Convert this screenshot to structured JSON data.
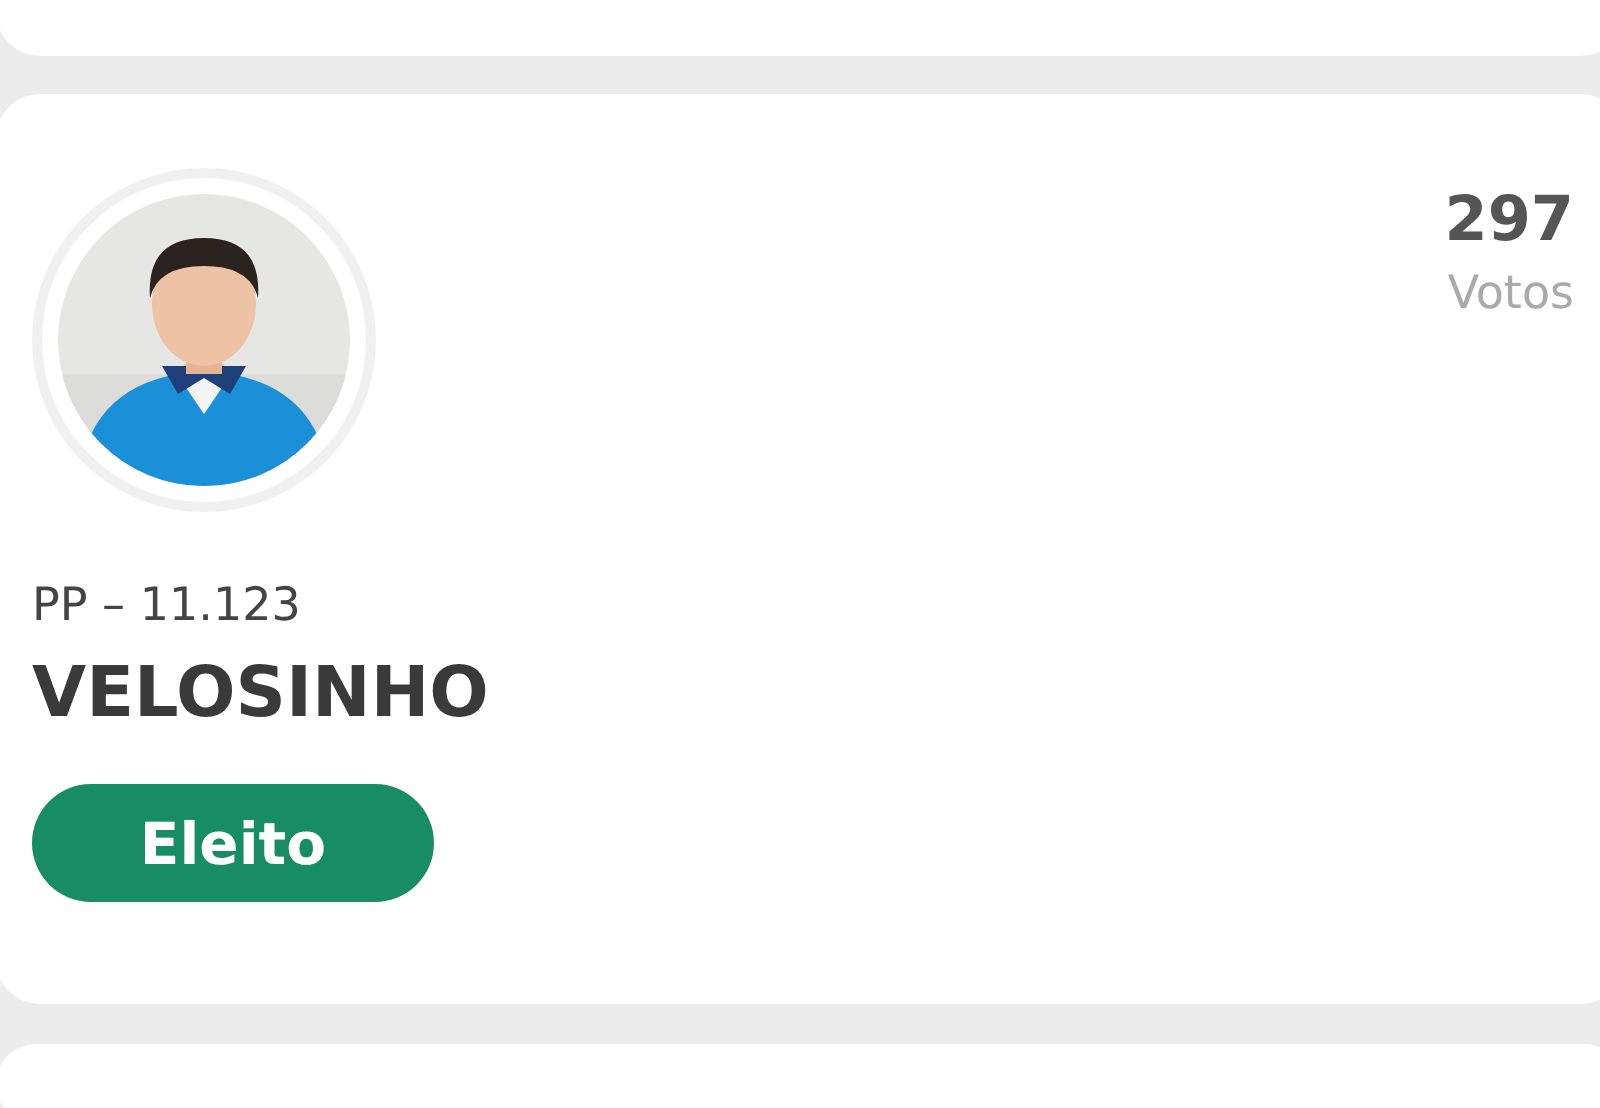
{
  "candidate": {
    "party": "PP – 11.123",
    "name": "VELOSINHO",
    "votes": "297",
    "votes_label": "Votos",
    "status": {
      "label": "Eleito",
      "kind": "elected"
    }
  }
}
